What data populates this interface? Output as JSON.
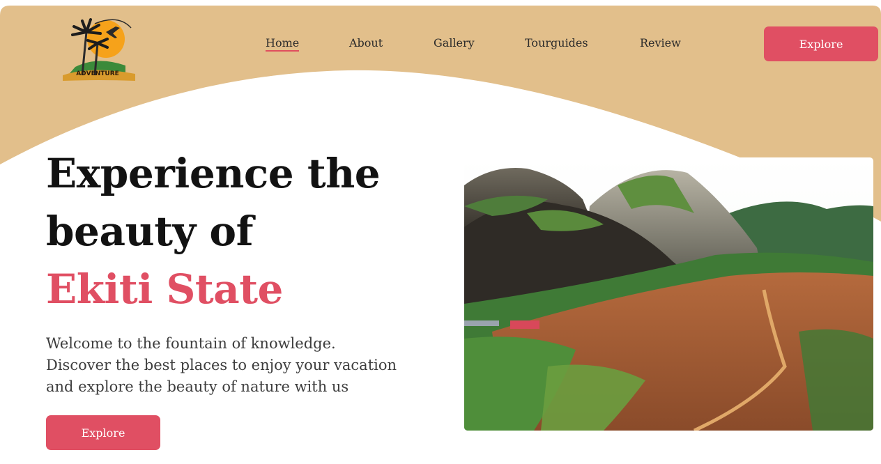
{
  "brand": {
    "logo_text": "ADVENTURE",
    "colors": {
      "accent": "#e04f63",
      "header": "#e2bf8b",
      "text": "#121212"
    }
  },
  "nav": {
    "items": [
      {
        "label": "Home",
        "active": true
      },
      {
        "label": "About"
      },
      {
        "label": "Gallery"
      },
      {
        "label": "Tourguides"
      },
      {
        "label": "Review"
      }
    ],
    "cta_label": "Explore"
  },
  "hero": {
    "title_line1": "Experience the",
    "title_line2": "beauty of",
    "title_highlight": "Ekiti State",
    "desc_line1": "Welcome to the fountain of knowledge.",
    "desc_line2": "Discover the best places to enjoy your vacation",
    "desc_line3": "and explore the beauty of nature with us",
    "cta_label": "Explore",
    "image_alt": "Ikogosi hills landscape"
  }
}
